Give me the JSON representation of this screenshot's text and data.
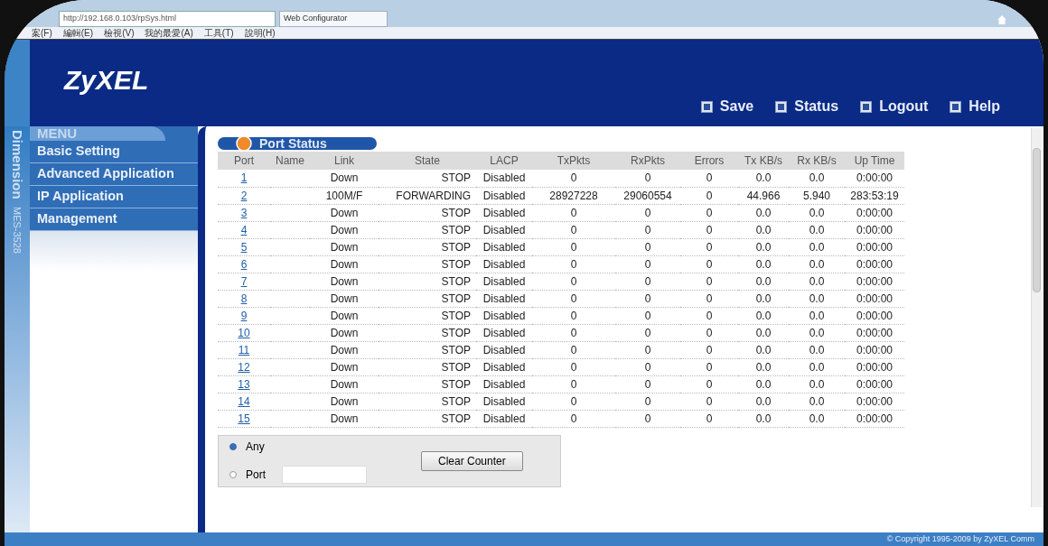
{
  "browser": {
    "address": "http://192.168.0.103/rpSys.html",
    "tab": "Web Configurator",
    "menu": [
      "案(F)",
      "編輯(E)",
      "檢視(V)",
      "我的最愛(A)",
      "工具(T)",
      "說明(H)"
    ]
  },
  "header": {
    "logo": "ZyXEL",
    "links": [
      "Save",
      "Status",
      "Logout",
      "Help"
    ]
  },
  "side_label": {
    "product": "Dimension",
    "model": "MES-3528"
  },
  "menu": {
    "title": "MENU",
    "items": [
      "Basic Setting",
      "Advanced Application",
      "IP Application",
      "Management"
    ]
  },
  "panel": {
    "title": "Port Status"
  },
  "table": {
    "columns": [
      "Port",
      "Name",
      "Link",
      "State",
      "LACP",
      "TxPkts",
      "RxPkts",
      "Errors",
      "Tx KB/s",
      "Rx KB/s",
      "Up Time"
    ],
    "rows": [
      [
        "1",
        "",
        "Down",
        "STOP",
        "Disabled",
        "0",
        "0",
        "0",
        "0.0",
        "0.0",
        "0:00:00"
      ],
      [
        "2",
        "",
        "100M/F",
        "FORWARDING",
        "Disabled",
        "28927228",
        "29060554",
        "0",
        "44.966",
        "5.940",
        "283:53:19"
      ],
      [
        "3",
        "",
        "Down",
        "STOP",
        "Disabled",
        "0",
        "0",
        "0",
        "0.0",
        "0.0",
        "0:00:00"
      ],
      [
        "4",
        "",
        "Down",
        "STOP",
        "Disabled",
        "0",
        "0",
        "0",
        "0.0",
        "0.0",
        "0:00:00"
      ],
      [
        "5",
        "",
        "Down",
        "STOP",
        "Disabled",
        "0",
        "0",
        "0",
        "0.0",
        "0.0",
        "0:00:00"
      ],
      [
        "6",
        "",
        "Down",
        "STOP",
        "Disabled",
        "0",
        "0",
        "0",
        "0.0",
        "0.0",
        "0:00:00"
      ],
      [
        "7",
        "",
        "Down",
        "STOP",
        "Disabled",
        "0",
        "0",
        "0",
        "0.0",
        "0.0",
        "0:00:00"
      ],
      [
        "8",
        "",
        "Down",
        "STOP",
        "Disabled",
        "0",
        "0",
        "0",
        "0.0",
        "0.0",
        "0:00:00"
      ],
      [
        "9",
        "",
        "Down",
        "STOP",
        "Disabled",
        "0",
        "0",
        "0",
        "0.0",
        "0.0",
        "0:00:00"
      ],
      [
        "10",
        "",
        "Down",
        "STOP",
        "Disabled",
        "0",
        "0",
        "0",
        "0.0",
        "0.0",
        "0:00:00"
      ],
      [
        "11",
        "",
        "Down",
        "STOP",
        "Disabled",
        "0",
        "0",
        "0",
        "0.0",
        "0.0",
        "0:00:00"
      ],
      [
        "12",
        "",
        "Down",
        "STOP",
        "Disabled",
        "0",
        "0",
        "0",
        "0.0",
        "0.0",
        "0:00:00"
      ],
      [
        "13",
        "",
        "Down",
        "STOP",
        "Disabled",
        "0",
        "0",
        "0",
        "0.0",
        "0.0",
        "0:00:00"
      ],
      [
        "14",
        "",
        "Down",
        "STOP",
        "Disabled",
        "0",
        "0",
        "0",
        "0.0",
        "0.0",
        "0:00:00"
      ],
      [
        "15",
        "",
        "Down",
        "STOP",
        "Disabled",
        "0",
        "0",
        "0",
        "0.0",
        "0.0",
        "0:00:00"
      ]
    ]
  },
  "clear_form": {
    "options": [
      {
        "label": "Any",
        "selected": true
      },
      {
        "label": "Port",
        "selected": false
      }
    ],
    "button": "Clear Counter"
  },
  "footer": {
    "copyright": "© Copyright 1995-2009 by ZyXEL Comm"
  }
}
